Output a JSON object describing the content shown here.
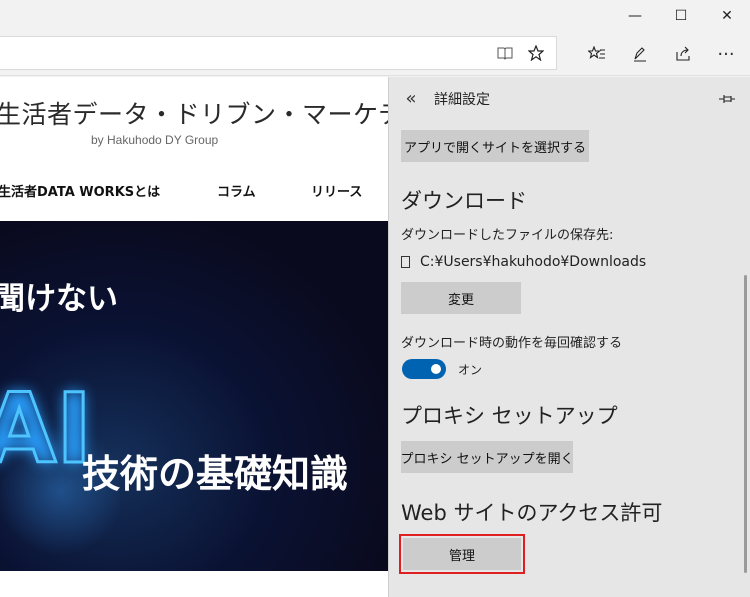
{
  "window": {
    "minimize_glyph": "—",
    "maximize_glyph": "☐",
    "close_glyph": "✕"
  },
  "navbar": {
    "reading_view_icon": "book-icon",
    "favorite_icon": "star-icon",
    "favorites_hub_icon": "favorites-list-icon",
    "notes_icon": "pen-icon",
    "share_icon": "share-icon",
    "more_glyph": "···"
  },
  "site": {
    "logo": "生活者データ・ドリブン・マーケティング通信",
    "subtitle": "by Hakuhodo DY Group",
    "nav": [
      "生活者DATA WORKSとは",
      "コラム",
      "リリース"
    ],
    "hero_line1": "聞けない",
    "hero_ai": "AI",
    "hero_line2": "技術の基礎知識"
  },
  "panel": {
    "title": "詳細設定",
    "open_sites_button": "アプリで開くサイトを選択する",
    "download_heading": "ダウンロード",
    "download_location_label": "ダウンロードしたファイルの保存先:",
    "download_path": "C:¥Users¥hakuhodo¥Downloads",
    "change_button": "変更",
    "ask_label": "ダウンロード時の動作を毎回確認する",
    "ask_toggle_state": "オン",
    "proxy_heading": "プロキシ セットアップ",
    "proxy_button": "プロキシ セットアップを開く",
    "permissions_heading": "Web サイトのアクセス許可",
    "manage_button": "管理"
  },
  "colors": {
    "toggle_on": "#0063b1",
    "highlight": "#e02020",
    "panel_bg": "#e6e6e6"
  }
}
